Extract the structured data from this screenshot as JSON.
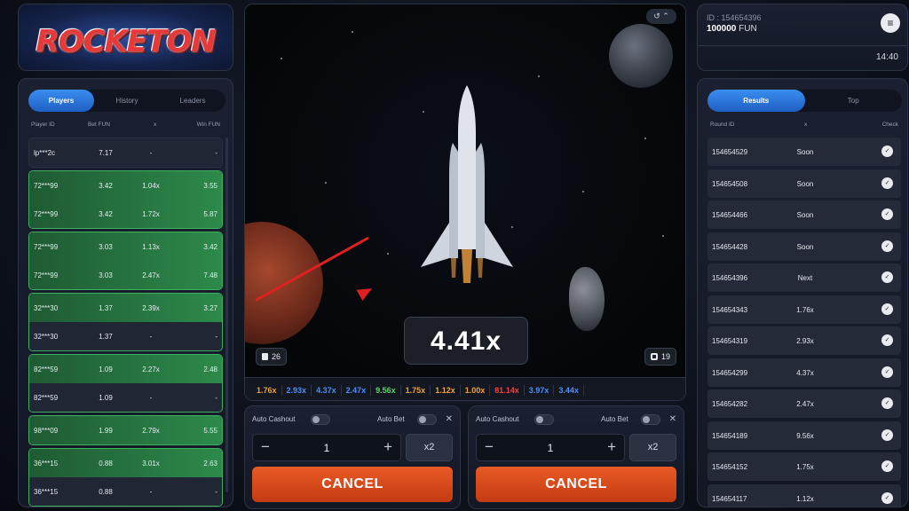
{
  "logo": {
    "text": "ROCKETON"
  },
  "players": {
    "tabs": [
      "Players",
      "History",
      "Leaders"
    ],
    "active_tab": "Players",
    "columns": [
      "Player ID",
      "Bet FUN",
      "x",
      "Win FUN"
    ],
    "groups": [
      {
        "win": false,
        "rows": [
          {
            "id": "lp***2c",
            "bet": "7.17",
            "x": "-",
            "win": "-",
            "green": false
          }
        ]
      },
      {
        "win": true,
        "rows": [
          {
            "id": "72***99",
            "bet": "3.42",
            "x": "1.04x",
            "win": "3.55",
            "green": true
          },
          {
            "id": "72***99",
            "bet": "3.42",
            "x": "1.72x",
            "win": "5.87",
            "green": true
          }
        ]
      },
      {
        "win": true,
        "rows": [
          {
            "id": "72***99",
            "bet": "3.03",
            "x": "1.13x",
            "win": "3.42",
            "green": true
          },
          {
            "id": "72***99",
            "bet": "3.03",
            "x": "2.47x",
            "win": "7.48",
            "green": true
          }
        ]
      },
      {
        "win": true,
        "rows": [
          {
            "id": "32***30",
            "bet": "1.37",
            "x": "2.39x",
            "win": "3.27",
            "green": true
          },
          {
            "id": "32***30",
            "bet": "1.37",
            "x": "-",
            "win": "-",
            "green": false
          }
        ]
      },
      {
        "win": true,
        "rows": [
          {
            "id": "82***59",
            "bet": "1.09",
            "x": "2.27x",
            "win": "2.48",
            "green": true
          },
          {
            "id": "82***59",
            "bet": "1.09",
            "x": "-",
            "win": "-",
            "green": false
          }
        ]
      },
      {
        "win": true,
        "rows": [
          {
            "id": "98***09",
            "bet": "1.99",
            "x": "2.79x",
            "win": "5.55",
            "green": true
          }
        ]
      },
      {
        "win": true,
        "rows": [
          {
            "id": "36***15",
            "bet": "0.88",
            "x": "3.01x",
            "win": "2.63",
            "green": true
          },
          {
            "id": "36***15",
            "bet": "0.88",
            "x": "-",
            "win": "-",
            "green": false
          }
        ]
      }
    ]
  },
  "game": {
    "multiplier": "4.41x",
    "players_count": "26",
    "bets_count": "19",
    "history": [
      {
        "v": "1.76x",
        "c": "#f0a23a"
      },
      {
        "v": "2.93x",
        "c": "#4d8ff2"
      },
      {
        "v": "4.37x",
        "c": "#4d8ff2"
      },
      {
        "v": "2.47x",
        "c": "#4d8ff2"
      },
      {
        "v": "9.56x",
        "c": "#5fd36a"
      },
      {
        "v": "1.75x",
        "c": "#f0a23a"
      },
      {
        "v": "1.12x",
        "c": "#f0a23a"
      },
      {
        "v": "1.00x",
        "c": "#f0a23a"
      },
      {
        "v": "81.14x",
        "c": "#f04040"
      },
      {
        "v": "3.97x",
        "c": "#4d8ff2"
      },
      {
        "v": "3.44x",
        "c": "#4d8ff2"
      }
    ]
  },
  "bets": [
    {
      "auto_cashout": "Auto Cashout",
      "auto_bet": "Auto Bet",
      "amount": "1",
      "double": "x2",
      "action": "CANCEL"
    },
    {
      "auto_cashout": "Auto Cashout",
      "auto_bet": "Auto Bet",
      "amount": "1",
      "double": "x2",
      "action": "CANCEL"
    }
  ],
  "account": {
    "id": "ID : 154654396",
    "balance": "100000",
    "currency": "FUN",
    "time": "14:40"
  },
  "results": {
    "tabs": [
      "Results",
      "Top"
    ],
    "active_tab": "Results",
    "columns": [
      "Round ID",
      "x",
      "Check"
    ],
    "rows": [
      {
        "round": "154654529",
        "x": "Soon"
      },
      {
        "round": "154654508",
        "x": "Soon"
      },
      {
        "round": "154654466",
        "x": "Soon"
      },
      {
        "round": "154654428",
        "x": "Soon"
      },
      {
        "round": "154654396",
        "x": "Next"
      },
      {
        "round": "154654343",
        "x": "1.76x"
      },
      {
        "round": "154654319",
        "x": "2.93x"
      },
      {
        "round": "154654299",
        "x": "4.37x"
      },
      {
        "round": "154654282",
        "x": "2.47x"
      },
      {
        "round": "154654189",
        "x": "9.56x"
      },
      {
        "round": "154654152",
        "x": "1.75x"
      },
      {
        "round": "154654117",
        "x": "1.12x"
      }
    ]
  }
}
